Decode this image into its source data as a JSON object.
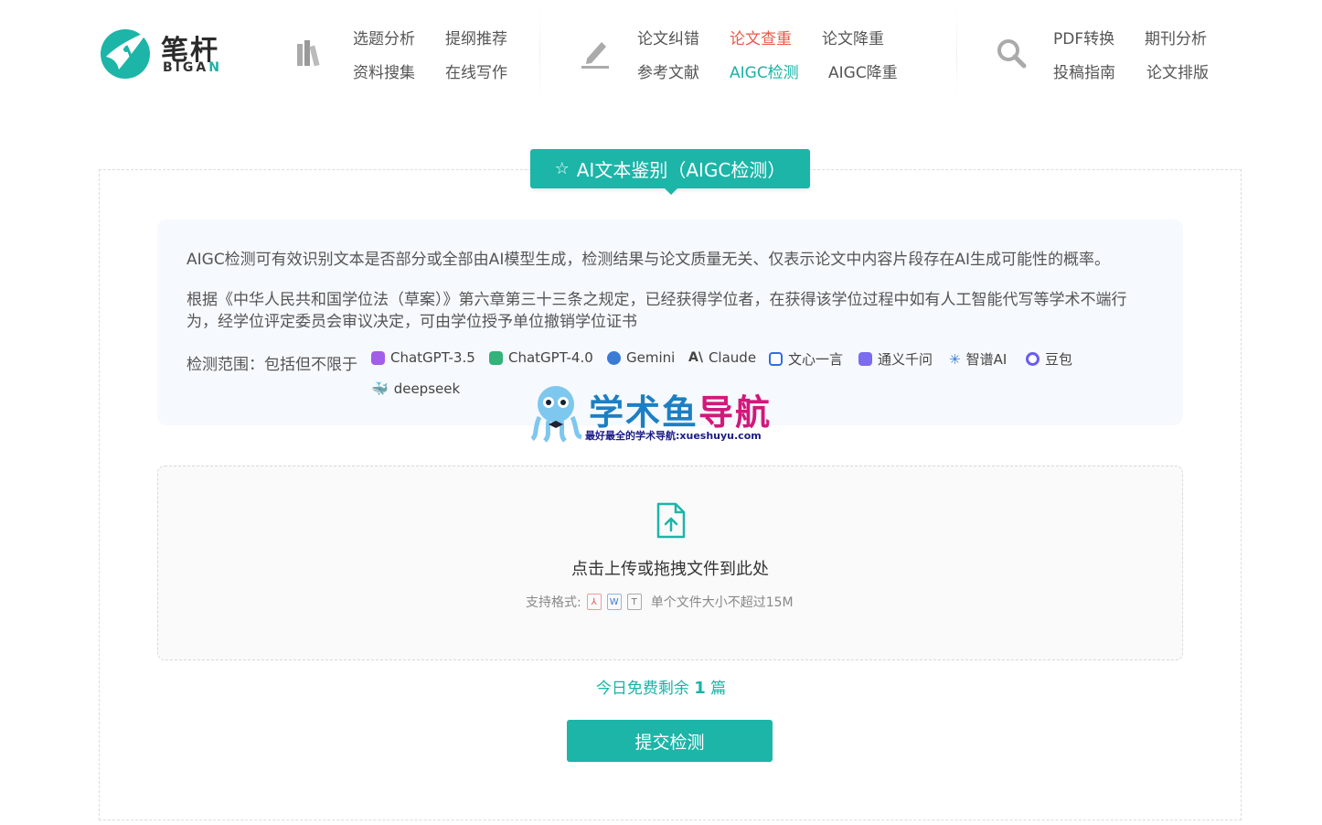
{
  "logo": {
    "cn": "笔杆",
    "en_main": "BIGA",
    "en_accent": "N"
  },
  "nav": {
    "group1": [
      "选题分析",
      "提纲推荐",
      "资料搜集",
      "在线写作"
    ],
    "group2": [
      "论文纠错",
      "论文查重",
      "论文降重",
      "参考文献",
      "AIGC检测",
      "AIGC降重"
    ],
    "group3": [
      "PDF转换",
      "期刊分析",
      "投稿指南",
      "论文排版"
    ],
    "active": "AIGC检测",
    "highlight": "论文查重"
  },
  "title": "AI文本鉴别（AIGC检测）",
  "info": {
    "p1": "AIGC检测可有效识别文本是否部分或全部由AI模型生成，检测结果与论文质量无关、仅表示论文中内容片段存在AI生成可能性的概率。",
    "p2": "根据《中华人民共和国学位法（草案）》第六章第三十三条之规定，已经获得学位者，在获得该学位过程中如有人工智能代写等学术不端行为，经学位评定委员会审议决定，可由学位授予单位撤销学位证书",
    "scope_label": "检测范围：包括但不限于",
    "models": [
      "ChatGPT-3.5",
      "ChatGPT-4.0",
      "Gemini",
      "Claude",
      "文心一言",
      "通义千问",
      "智谱AI",
      "豆包",
      "deepseek"
    ]
  },
  "watermark": {
    "title_a": "学术鱼",
    "title_b": "导航",
    "subtitle": "最好最全的学术导航:xueshuyu.com"
  },
  "upload": {
    "text": "点击上传或拖拽文件到此处",
    "formats_label": "支持格式:",
    "limit": "单个文件大小不超过15M"
  },
  "remain": {
    "prefix": "今日免费剩余",
    "count": "1",
    "suffix": "篇"
  },
  "submit_label": "提交检测",
  "colors": {
    "accent": "#1cb5a8",
    "red": "#e85a4a",
    "watermark_blue": "#1c7fc4",
    "watermark_pink": "#d0197b"
  }
}
